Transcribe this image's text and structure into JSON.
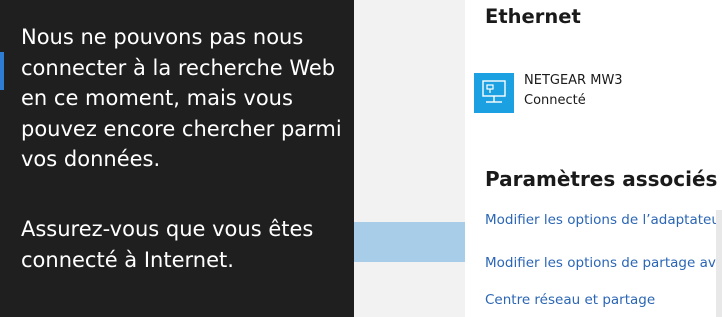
{
  "search_flyout": {
    "message_line_1": "Nous ne pouvons pas nous connecter à la recherche Web en ce moment, mais vous pouvez encore chercher parmi vos données.",
    "message_line_2": "Assurez-vous que vous êtes connecté à Internet."
  },
  "ethernet": {
    "heading": "Ethernet",
    "network": {
      "icon": "network-adapter-icon",
      "name": "NETGEAR MW3",
      "status": "Connecté"
    }
  },
  "related_settings": {
    "heading": "Paramètres associés",
    "links": [
      "Modifier les options de l’adaptateur",
      "Modifier les options de partage avan",
      "Centre réseau et partage"
    ]
  },
  "colors": {
    "flyout_background": "#1f1f1f",
    "accent": "#2d7dd2",
    "network_tile": "#1ba1e2",
    "link": "#2b66b5"
  }
}
